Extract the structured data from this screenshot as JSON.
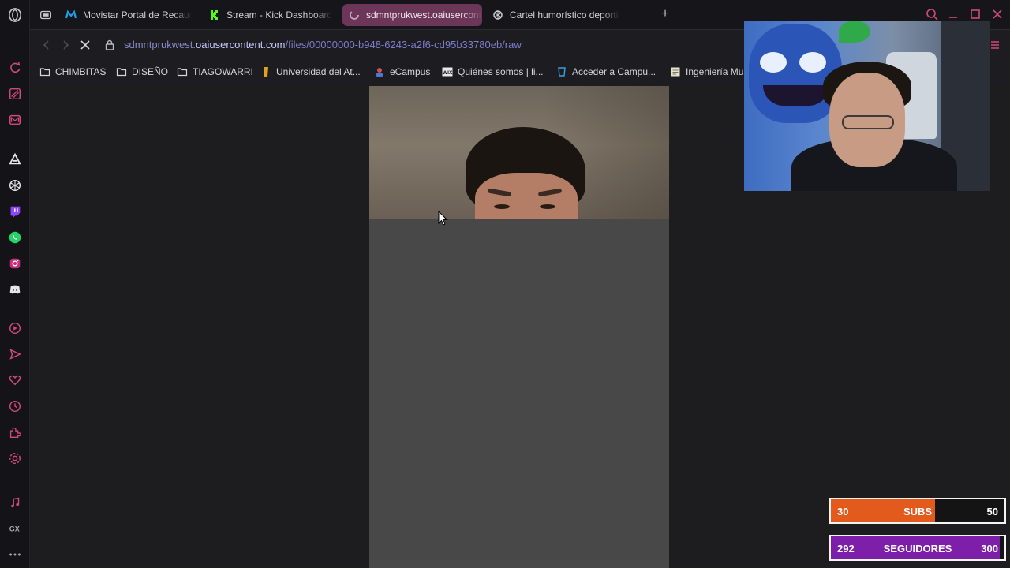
{
  "tabs": [
    {
      "label": "Movistar Portal de Recaudo",
      "icon": "movistar-icon",
      "active": false
    },
    {
      "label": "Stream - Kick Dashboard",
      "icon": "kick-icon",
      "active": false
    },
    {
      "label": "sdmntprukwest.oaiusercontent.com",
      "icon": "loading-spinner-icon",
      "active": true
    },
    {
      "label": "Cartel humorístico deportivo",
      "icon": "chatgpt-icon",
      "active": false
    }
  ],
  "new_tab_label": "+",
  "address": {
    "url_sub": "sdmntprukwest.",
    "url_host": "oaiusercontent.com",
    "url_path": "/files/00000000-b948-6243-a2f6-cd95b33780eb/raw"
  },
  "bookmarks": [
    {
      "label": "CHIMBITAS",
      "icon": "folder-icon"
    },
    {
      "label": "DISEÑO",
      "icon": "folder-icon"
    },
    {
      "label": "TIAGOWARRI",
      "icon": "folder-icon"
    },
    {
      "label": "Universidad del At...",
      "icon": "university-icon"
    },
    {
      "label": "eCampus",
      "icon": "ecampus-icon"
    },
    {
      "label": "Quiénes somos | li...",
      "icon": "wix-icon"
    },
    {
      "label": "Acceder a Campu...",
      "icon": "campus-icon"
    },
    {
      "label": "Ingeniería Mu",
      "icon": "doc-icon"
    }
  ],
  "goals": {
    "subs": {
      "current": "30",
      "label": "SUBS",
      "max": "50",
      "progress": 0.6,
      "color": "#e25a1c"
    },
    "followers": {
      "current": "292",
      "label": "SEGUIDORES",
      "max": "300",
      "progress": 0.973,
      "color": "#7d1fa8"
    }
  },
  "colors": {
    "active_tab": "#6c3658",
    "url_text": "#8c8cff"
  }
}
